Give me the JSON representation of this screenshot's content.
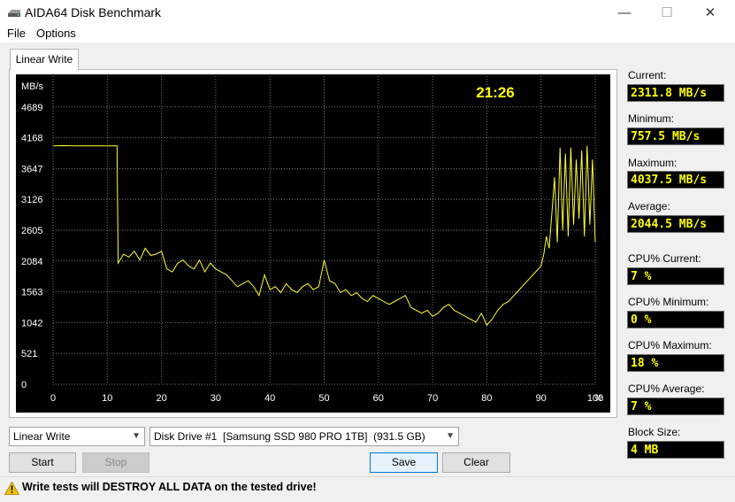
{
  "window": {
    "title": "AIDA64 Disk Benchmark",
    "minimize": "—",
    "maximize": "☐",
    "close": "✕"
  },
  "menu": [
    "File",
    "Options"
  ],
  "tab": "Linear Write",
  "chart_data": {
    "type": "line",
    "title": "",
    "ylabel": "MB/s",
    "xlabel": "%",
    "timer": "21:26",
    "xlim": [
      0,
      100
    ],
    "ylim": [
      0,
      5210
    ],
    "yticks": [
      0,
      521,
      1042,
      1563,
      2084,
      2605,
      3126,
      3647,
      4168,
      4689
    ],
    "xticks": [
      0,
      10,
      20,
      30,
      40,
      50,
      60,
      70,
      80,
      90,
      100
    ],
    "xtick_labels": [
      "0",
      "10",
      "20",
      "30",
      "40",
      "50",
      "60",
      "70",
      "80",
      "90",
      "100"
    ],
    "grid": true,
    "line_color": "#ffff33",
    "series": [
      {
        "x": [
          0,
          2,
          4,
          6,
          8,
          10,
          11.8,
          12,
          13,
          14,
          15,
          16,
          17,
          18,
          19,
          20,
          21,
          22,
          23,
          24,
          25,
          26,
          27,
          28,
          29,
          30,
          31,
          32,
          33,
          34,
          35,
          36,
          37,
          38,
          39,
          40,
          41,
          42,
          43,
          44,
          45,
          46,
          47,
          48,
          49,
          50,
          51,
          52,
          53,
          54,
          55,
          56,
          57,
          58,
          59,
          60,
          61,
          62,
          63,
          64,
          65,
          66,
          67,
          68,
          69,
          70,
          71,
          72,
          73,
          74,
          75,
          76,
          77,
          78,
          79,
          80,
          81,
          82,
          83,
          84,
          85,
          86,
          87,
          88,
          89,
          90,
          90.5,
          91,
          91.5,
          92,
          92.5,
          93,
          93.5,
          94,
          94.5,
          95,
          95.5,
          96,
          96.5,
          97,
          97.5,
          98,
          98.5,
          99,
          99.5,
          100
        ],
        "y": [
          4030,
          4035,
          4030,
          4032,
          4030,
          4030,
          4030,
          2050,
          2200,
          2150,
          2250,
          2100,
          2300,
          2180,
          2200,
          2250,
          1950,
          1900,
          2050,
          2100,
          2000,
          1950,
          2100,
          1900,
          2050,
          1950,
          1900,
          1850,
          1750,
          1650,
          1700,
          1750,
          1650,
          1500,
          1850,
          1600,
          1650,
          1550,
          1700,
          1600,
          1550,
          1650,
          1700,
          1600,
          1650,
          2100,
          1750,
          1700,
          1550,
          1600,
          1500,
          1550,
          1450,
          1400,
          1500,
          1450,
          1400,
          1350,
          1400,
          1450,
          1500,
          1300,
          1250,
          1200,
          1250,
          1150,
          1200,
          1300,
          1350,
          1250,
          1200,
          1150,
          1100,
          1050,
          1200,
          1000,
          1100,
          1250,
          1350,
          1400,
          1500,
          1600,
          1700,
          1800,
          1900,
          2000,
          2200,
          2500,
          2300,
          2900,
          3500,
          2400,
          4000,
          2600,
          3900,
          2500,
          4000,
          2700,
          3800,
          2800,
          3950,
          2500,
          4030,
          2700,
          3800,
          2400
        ]
      }
    ]
  },
  "stats": {
    "current": {
      "label": "Current:",
      "value": "2311.8 MB/s"
    },
    "minimum": {
      "label": "Minimum:",
      "value": "757.5 MB/s"
    },
    "maximum": {
      "label": "Maximum:",
      "value": "4037.5 MB/s"
    },
    "average": {
      "label": "Average:",
      "value": "2044.5 MB/s"
    },
    "cpu_current": {
      "label": "CPU% Current:",
      "value": "7 %"
    },
    "cpu_minimum": {
      "label": "CPU% Minimum:",
      "value": "0 %"
    },
    "cpu_maximum": {
      "label": "CPU% Maximum:",
      "value": "18 %"
    },
    "cpu_average": {
      "label": "CPU% Average:",
      "value": "7 %"
    },
    "block_size": {
      "label": "Block Size:",
      "value": "4 MB"
    }
  },
  "controls": {
    "test_select": "Linear Write",
    "drive_select": "Disk Drive #1  [Samsung SSD 980 PRO 1TB]  (931.5 GB)",
    "start": "Start",
    "stop": "Stop",
    "save": "Save",
    "clear": "Clear"
  },
  "status": {
    "warning": "Write tests will DESTROY ALL DATA on the tested drive!"
  },
  "colors": {
    "chart_bg": "#000000",
    "grid": "#7a7a7a",
    "axis_text": "#ffffff",
    "value_text": "#ffff00"
  },
  "icons": {
    "app": "disk-drive-icon",
    "warning": "warning-triangle-icon"
  }
}
